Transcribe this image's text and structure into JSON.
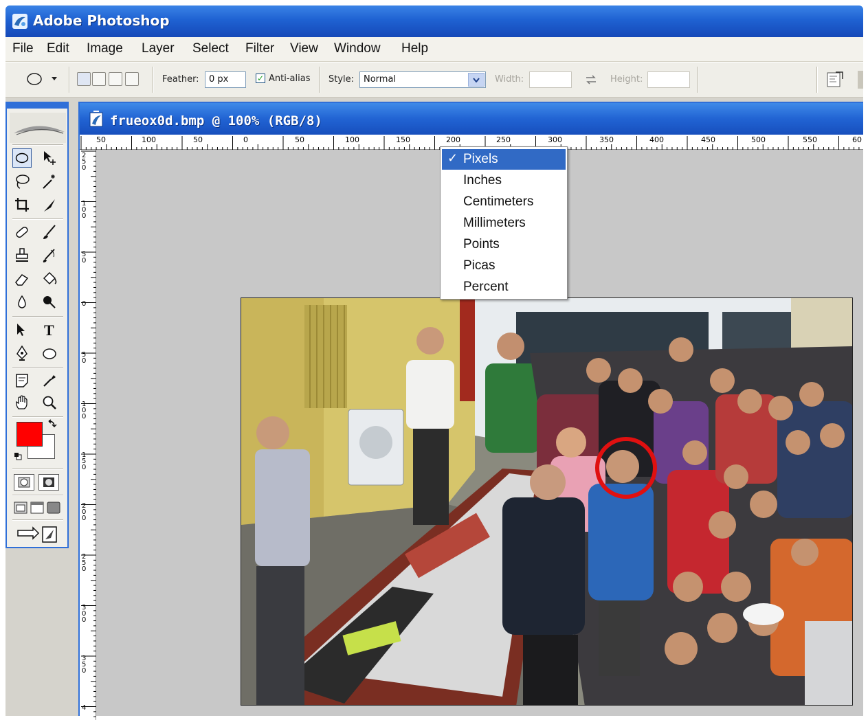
{
  "app": {
    "title": "Adobe Photoshop"
  },
  "menu": [
    "File",
    "Edit",
    "Image",
    "Layer",
    "Select",
    "Filter",
    "View",
    "Window",
    "Help"
  ],
  "options": {
    "feather_label": "Feather:",
    "feather_value": "0 px",
    "antialias_label": "Anti-alias",
    "antialias_checked": true,
    "style_label": "Style:",
    "style_value": "Normal",
    "width_label": "Width:",
    "height_label": "Height:"
  },
  "document": {
    "title": "frueox0d.bmp @ 100% (RGB/8)"
  },
  "ruler_top": [
    "50",
    "100",
    "50",
    "0",
    "50",
    "100",
    "150",
    "200",
    "250",
    "300",
    "350",
    "400",
    "450",
    "500",
    "550",
    "60"
  ],
  "ruler_left": [
    "250",
    "100",
    "50",
    "0",
    "50",
    "100",
    "150",
    "200",
    "250",
    "300",
    "350",
    "4"
  ],
  "unit_menu": {
    "selected": "Pixels",
    "items": [
      "Pixels",
      "Inches",
      "Centimeters",
      "Millimeters",
      "Points",
      "Picas",
      "Percent"
    ]
  },
  "colors": {
    "foreground": "#ff0000",
    "background": "#ffffff",
    "highlight_circle": "#e01010"
  },
  "tools": [
    "marquee-icon",
    "move-icon",
    "lasso-icon",
    "magic-wand-icon",
    "crop-icon",
    "slice-icon",
    "healing-icon",
    "brush-icon",
    "stamp-icon",
    "history-brush-icon",
    "eraser-icon",
    "bucket-icon",
    "blur-icon",
    "dodge-icon",
    "path-select-icon",
    "type-icon",
    "pen-icon",
    "shape-icon",
    "notes-icon",
    "eyedropper-icon",
    "hand-icon",
    "zoom-icon"
  ]
}
